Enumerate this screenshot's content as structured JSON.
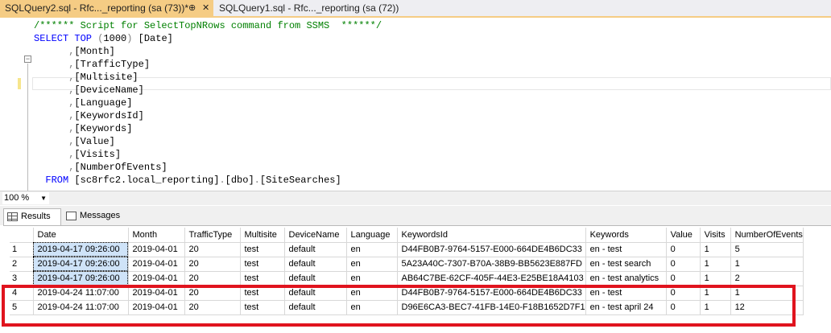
{
  "tabs": [
    {
      "label": "SQLQuery2.sql - Rfc..._reporting (sa (73))*",
      "pin": "⊕",
      "close": "✕"
    },
    {
      "label": "SQLQuery1.sql - Rfc..._reporting (sa (72))"
    }
  ],
  "editor": {
    "lines": [
      "/****** Script for SelectTopNRows command from SSMS  ******/",
      "SELECT TOP (1000) [Date]",
      "      ,[Month]",
      "      ,[TrafficType]",
      "      ,[Multisite]",
      "      ,[DeviceName]",
      "      ,[Language]",
      "      ,[KeywordsId]",
      "      ,[Keywords]",
      "      ,[Value]",
      "      ,[Visits]",
      "      ,[NumberOfEvents]",
      "  FROM [sc8rfc2.local_reporting].[dbo].[SiteSearches]"
    ]
  },
  "zoom": {
    "value": "100 %"
  },
  "result_tabs": {
    "results": "Results",
    "messages": "Messages"
  },
  "grid": {
    "columns": [
      "Date",
      "Month",
      "TrafficType",
      "Multisite",
      "DeviceName",
      "Language",
      "KeywordsId",
      "Keywords",
      "Value",
      "Visits",
      "NumberOfEvents"
    ],
    "rows": [
      [
        "1",
        "2019-04-17 09:26:00",
        "2019-04-01",
        "20",
        "test",
        "default",
        "en",
        "D44FB0B7-9764-5157-E000-664DE4B6DC33",
        "en - test",
        "0",
        "1",
        "5"
      ],
      [
        "2",
        "2019-04-17 09:26:00",
        "2019-04-01",
        "20",
        "test",
        "default",
        "en",
        "5A23A40C-7307-B70A-38B9-BB5623E887FD",
        "en - test search",
        "0",
        "1",
        "1"
      ],
      [
        "3",
        "2019-04-17 09:26:00",
        "2019-04-01",
        "20",
        "test",
        "default",
        "en",
        "AB64C7BE-62CF-405F-44E3-E25BE18A4103",
        "en - test analytics",
        "0",
        "1",
        "2"
      ],
      [
        "4",
        "2019-04-24 11:07:00",
        "2019-04-01",
        "20",
        "test",
        "default",
        "en",
        "D44FB0B7-9764-5157-E000-664DE4B6DC33",
        "en - test",
        "0",
        "1",
        "1"
      ],
      [
        "5",
        "2019-04-24 11:07:00",
        "2019-04-01",
        "20",
        "test",
        "default",
        "en",
        "D96E6CA3-BEC7-41FB-14E0-F18B1652D7F1",
        "en - test april 24",
        "0",
        "1",
        "12"
      ]
    ]
  },
  "colors": {
    "active_tab": "#f5cc84",
    "selection": "#cfe3f8",
    "highlight": "#e0141e"
  }
}
